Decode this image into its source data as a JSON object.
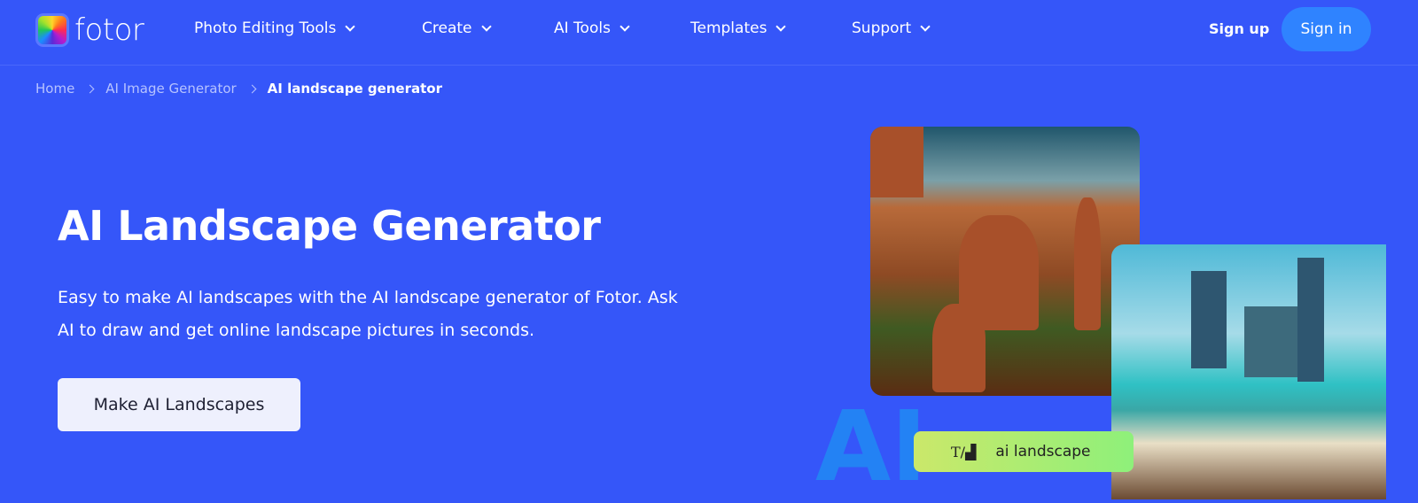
{
  "brand": {
    "name": "fotor"
  },
  "nav": {
    "items": [
      {
        "label": "Photo Editing Tools"
      },
      {
        "label": "Create"
      },
      {
        "label": "AI Tools"
      },
      {
        "label": "Templates"
      },
      {
        "label": "Support"
      }
    ],
    "sign_up": "Sign up",
    "sign_in": "Sign in"
  },
  "breadcrumb": [
    "Home",
    "AI Image Generator",
    "AI landscape generator"
  ],
  "hero": {
    "title": "AI Landscape Generator",
    "description": "Easy to make AI landscapes with the AI landscape generator of Fotor. Ask AI to draw and get online landscape pictures in seconds.",
    "cta": "Make AI Landscapes"
  },
  "showcase": {
    "watermark": "AI",
    "prompt": "ai landscape",
    "prompt_icon": "text-to-image-icon"
  },
  "colors": {
    "background": "#3556f9",
    "sign_in": "#2f83ff",
    "cta": "#eef0fd"
  }
}
